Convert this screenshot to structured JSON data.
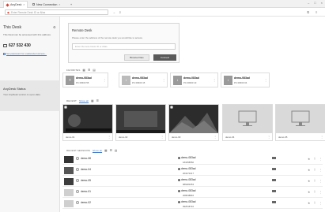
{
  "window": {
    "tabs": [
      {
        "label": "AnyDesk",
        "active": true
      },
      {
        "label": "New Connection",
        "active": false
      }
    ],
    "controls": {
      "minimize": "–",
      "maximize": "□",
      "close": "×"
    }
  },
  "toolbar": {
    "address_placeholder": "Enter Remote Desk ID or Alias",
    "forward_icon": "→",
    "download_icon": "⇩",
    "history_icon": "⏲",
    "menu_icon": "≡"
  },
  "sidebar": {
    "title": "This Desk",
    "description": "This Desk can be accessed with this address.",
    "desk_id": "627 532 430",
    "link_text": "Set password for unattended access...",
    "status_title": "AnyDesk Status",
    "status_text": "Your AnyDesk version is up-to-date."
  },
  "remote_desk": {
    "title": "Remote Desk",
    "description": "Please enter the address of the remote desk you would like to access.",
    "input_placeholder": "Enter Remote Desk ID or Alias",
    "browse_label": "Browse Files",
    "connect_label": "Connect"
  },
  "favorites": {
    "label": "FAVORITES",
    "items": [
      {
        "name": "demo-083ad",
        "id": "PC 08460 55",
        "icon": "+"
      },
      {
        "name": "demo-083ad",
        "id": "PC 08460 15",
        "icon": "↓"
      },
      {
        "name": "demo-083ad",
        "id": "PC 08460 10",
        "icon": "↓"
      },
      {
        "name": "demo-083ad",
        "id": "PC 08460 04",
        "icon": "↓"
      }
    ]
  },
  "recent": {
    "label": "RECENT",
    "show_all": "Show all",
    "items": [
      {
        "name": "demo-01"
      },
      {
        "name": "demo-02"
      },
      {
        "name": "demo-03"
      },
      {
        "name": "demo-04"
      },
      {
        "name": "demo-05"
      }
    ]
  },
  "discovered": {
    "label": "RECENT SESSIONS",
    "show_all": "Show all",
    "rows": [
      {
        "name": "demo-08",
        "alias": "demo-083ad",
        "id": "183458550"
      },
      {
        "name": "demo-04",
        "alias": "demo-083ad",
        "id": "203471017"
      },
      {
        "name": "demo-05",
        "alias": "demo-083ad",
        "id": "086281053"
      },
      {
        "name": "demo-01",
        "alias": "demo-083ad",
        "id": "208038816"
      },
      {
        "name": "demo-02",
        "alias": "demo-083ad",
        "id": "092518710"
      }
    ]
  }
}
